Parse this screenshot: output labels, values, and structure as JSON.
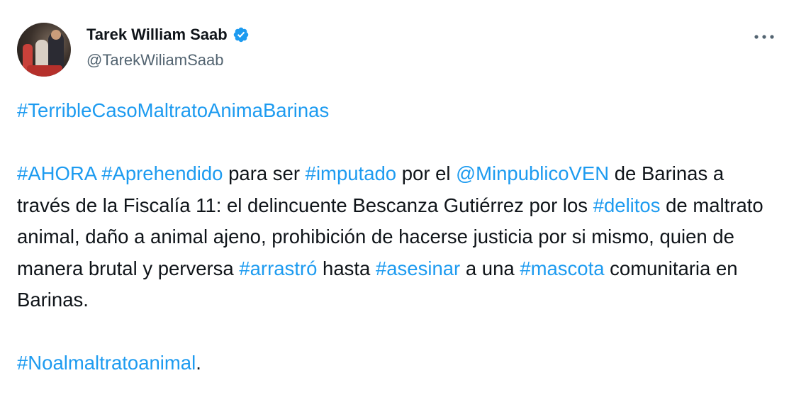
{
  "author": {
    "display_name": "Tarek William Saab",
    "handle": "@TarekWiliamSaab",
    "verified": true
  },
  "icons": {
    "verified": "verified-badge-icon",
    "more": "more-options-icon"
  },
  "colors": {
    "link": "#1d9bf0",
    "text": "#0f1419",
    "secondary": "#536471",
    "verified": "#1d9bf0"
  },
  "tweet": {
    "p1": {
      "tag": "#TerribleCasoMaltratoAnimaBarinas"
    },
    "p2": {
      "t1": "#AHORA",
      "s1": " ",
      "t2": "#Aprehendido",
      "s2": " para ser ",
      "t3": "#imputado",
      "s3": " por el ",
      "t4": "@MinpublicoVEN",
      "s4": " de Barinas a través de la Fiscalía 11: el delincuente Bescanza Gutiérrez por los ",
      "t5": "#delitos",
      "s5": " de maltrato animal, daño a animal ajeno, prohibición de hacerse justicia por si mismo, quien de manera brutal y perversa ",
      "t6": "#arrastró",
      "s6": " hasta ",
      "t7": "#asesinar",
      "s7": " a una ",
      "t8": "#mascota",
      "s8": " comunitaria en Barinas."
    },
    "p3": {
      "tag": "#Noalmaltratoanimal",
      "end": "."
    }
  }
}
